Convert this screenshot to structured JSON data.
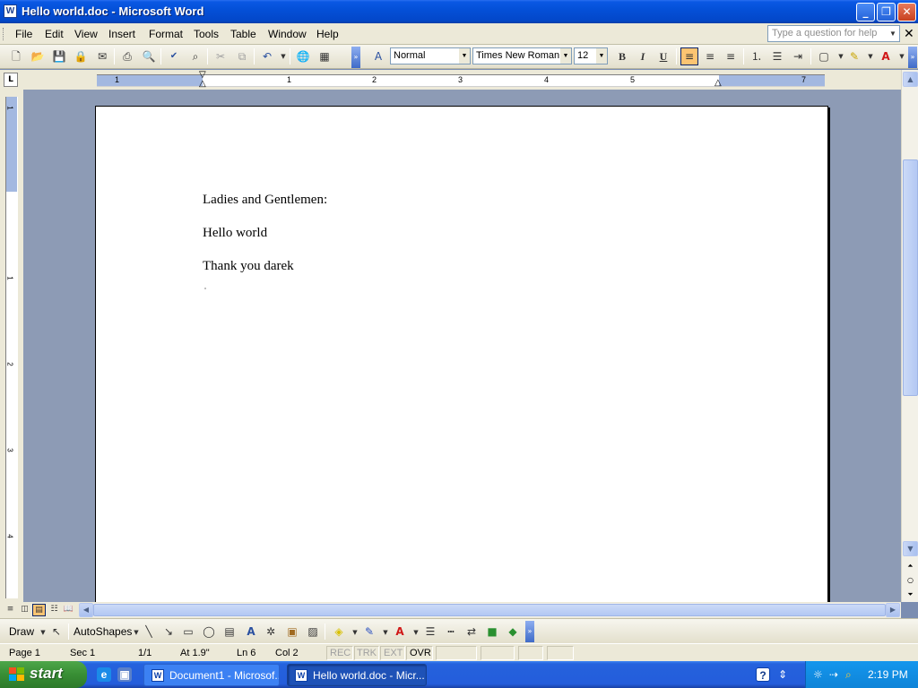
{
  "window": {
    "title": "Hello world.doc - Microsoft Word",
    "app_icon_letter": "W"
  },
  "menu": {
    "items": [
      "File",
      "Edit",
      "View",
      "Insert",
      "Format",
      "Tools",
      "Table",
      "Window",
      "Help"
    ],
    "help_placeholder": "Type a question for help"
  },
  "formatting": {
    "style": "Normal",
    "font": "Times New Roman",
    "size": "12",
    "bold_label": "B",
    "italic_label": "I",
    "underline_label": "U"
  },
  "ruler": {
    "tab_selector": "L",
    "numbers": [
      "1",
      "1",
      "2",
      "3",
      "4",
      "5",
      "7"
    ]
  },
  "vruler": {
    "numbers": [
      "1",
      "1",
      "2",
      "3",
      "4"
    ]
  },
  "document": {
    "lines": [
      "Ladies and Gentlemen:",
      "Hello world",
      "Thank you darek"
    ]
  },
  "drawbar": {
    "draw_label": "Draw",
    "autoshapes_label": "AutoShapes"
  },
  "status": {
    "page": "Page 1",
    "sec": "Sec 1",
    "pages": "1/1",
    "at": "At 1.9\"",
    "ln": "Ln 6",
    "col": "Col 2",
    "rec": "REC",
    "trk": "TRK",
    "ext": "EXT",
    "ovr": "OVR"
  },
  "taskbar": {
    "start_label": "start",
    "tasks": [
      "Document1 - Microsof...",
      "Hello world.doc - Micr..."
    ],
    "clock": "2:19 PM"
  },
  "colors": {
    "titlebar": "#0450d8",
    "taskbar": "#245ddb",
    "start": "#388e34",
    "page_bg": "#ffffff",
    "workspace": "#8d9bb5"
  }
}
